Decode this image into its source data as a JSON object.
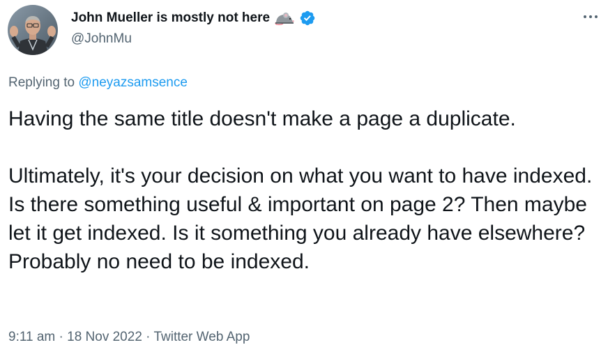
{
  "author": {
    "display_name": "John Mueller is mostly not here",
    "handle": "@JohnMu",
    "status_emoji": "mouse-emoji-icon",
    "verified": true,
    "verified_color": "#1d9bf0"
  },
  "reply": {
    "prefix": "Replying to",
    "mention": "@neyazsamsence"
  },
  "tweet": {
    "paragraph_1": "Having the same title doesn't make a page a duplicate.",
    "paragraph_2": "Ultimately, it's your decision on what you want to have indexed. Is there something useful & important on page 2? Then maybe let it get indexed. Is it something you already have elsewhere? Probably no need to be indexed."
  },
  "meta": {
    "time": "9:11 am",
    "separator": "·",
    "date": "18 Nov 2022",
    "source": "Twitter Web App"
  },
  "colors": {
    "text": "#0f1419",
    "secondary": "#536471",
    "link": "#1d9bf0"
  }
}
